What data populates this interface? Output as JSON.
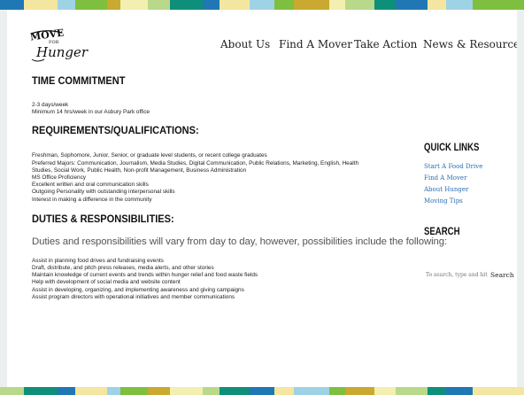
{
  "brand": {
    "logo_words": [
      "MOVE",
      "FOR",
      "Hunger"
    ],
    "stripe_colors": [
      "#1f78b4",
      "#7fbf3f",
      "#b8d98a",
      "#f4e6a0",
      "#c9a92f",
      "#0e8f7a",
      "#9ed3e5",
      "#f2efb0"
    ]
  },
  "nav": {
    "items": [
      "About Us",
      "Find A Mover",
      "Take Action",
      "News & Resources"
    ]
  },
  "main": {
    "time_title": "TIME COMMITMENT",
    "time_lines": [
      "2-3 days/week",
      "Minimum 14 hrs/week in our Asbury Park office"
    ],
    "req_title": "REQUIREMENTS/QUALIFICATIONS:",
    "req_lines": [
      "Freshman, Sophomore, Junior, Senior, or graduate level students, or recent college graduates",
      "Preferred Majors: Communication, Journalism, Media Studies, Digital Communication, Public Relations, Marketing, English, Health",
      "Studies, Social Work, Public Health, Non-profit Management, Business Administration",
      "MS Office Proficiency",
      "Excellent written and oral communication skills",
      "Outgoing Personality with outstanding interpersonal skills",
      "Interest in making a difference in the community"
    ],
    "duties_title": "DUTIES & RESPONSIBILITIES:",
    "duties_lead": "Duties and responsibilities will vary from day to day, however, possibilities include the following:",
    "duties_lines": [
      "Assist in planning food drives and fundraising events",
      "Draft, distribute, and pitch press releases, media alerts, and other stories",
      "Maintain knowledge of current events and trends within hunger relief and food waste fields",
      "Help with development of social media and website content",
      "Assist in developing, organizing, and implementing awareness and giving campaigns",
      "Assist program directors with operational initiatives and member communications"
    ]
  },
  "sidebar": {
    "quick_links_title": "QUICK LINKS",
    "quick_links": [
      "Start A Food Drive",
      "Find A Mover",
      "About Hunger",
      "Moving Tips"
    ],
    "search_title": "SEARCH",
    "search_placeholder": "To search, type and hit enter",
    "search_button": "Search"
  }
}
